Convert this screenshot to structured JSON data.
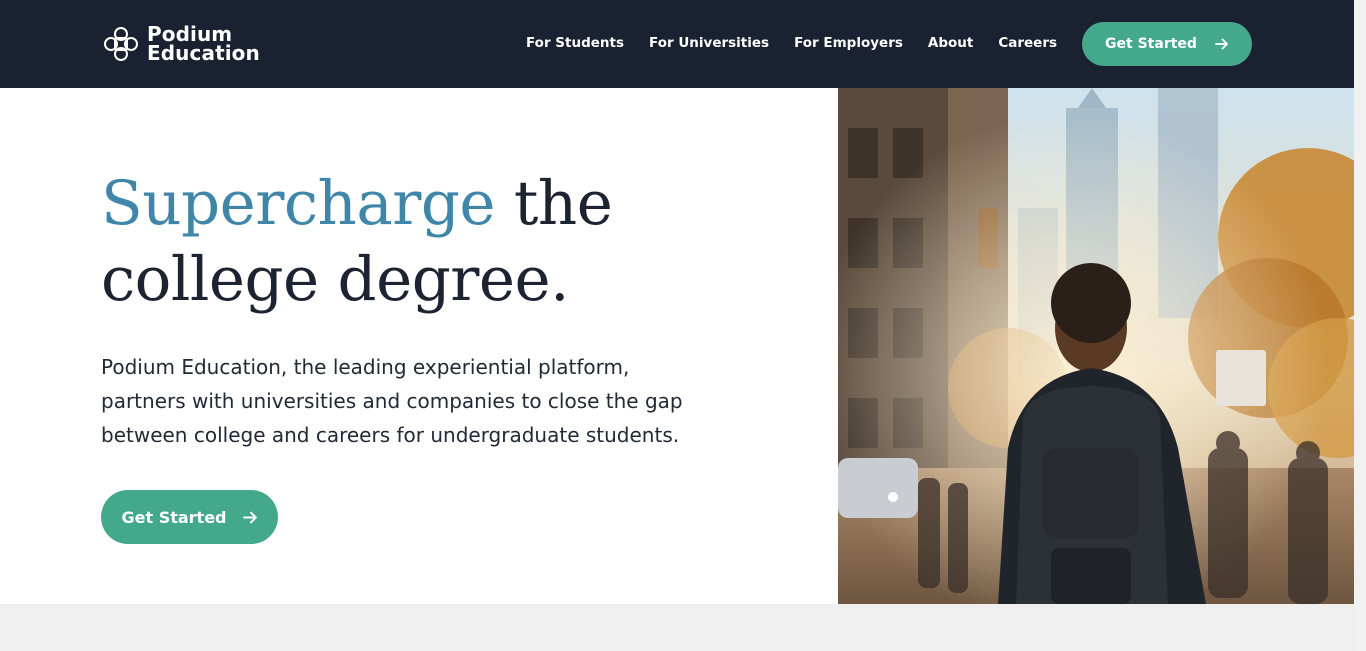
{
  "brand": {
    "line1": "Podium",
    "line2": "Education",
    "logo_icon": "podium-knot-icon"
  },
  "nav": {
    "items": [
      {
        "label": "For Students"
      },
      {
        "label": "For Universities"
      },
      {
        "label": "For Employers"
      },
      {
        "label": "About"
      },
      {
        "label": "Careers"
      }
    ],
    "cta_label": "Get Started"
  },
  "hero": {
    "title_accent": "Supercharge",
    "title_rest_line1": " the",
    "title_line2": "college degree.",
    "description": "Podium Education, the leading experiential platform, partners with universities and companies to close the gap between college and careers for undergraduate students.",
    "cta_label": "Get Started"
  },
  "colors": {
    "header_bg": "#1a2130",
    "accent_green": "#44a98a",
    "accent_blue": "#3f86a9",
    "text_dark": "#1c2331"
  }
}
